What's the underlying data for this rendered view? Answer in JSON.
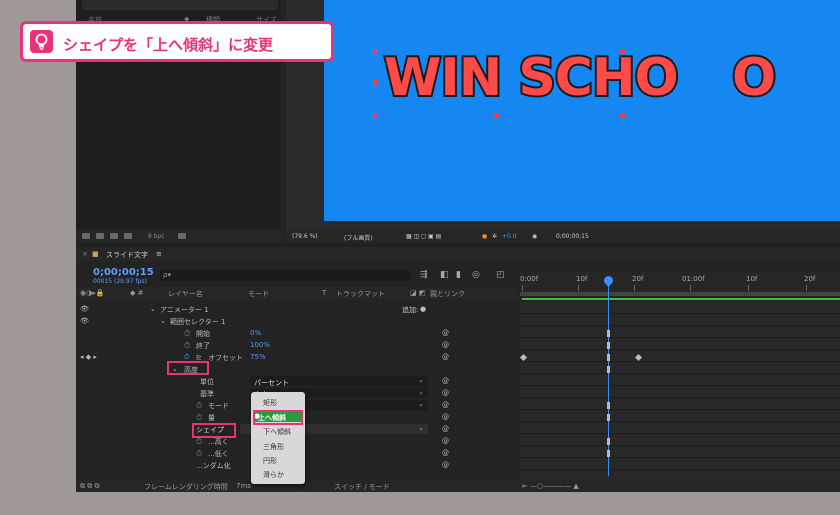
{
  "callout": {
    "text": "シェイプを「上へ傾斜」に変更",
    "icon": "lightbulb-icon",
    "color": "#e83279"
  },
  "project": {
    "col_name": "名前",
    "col_type": "種類",
    "col_size": "サイズ",
    "bpc": "8 bpc"
  },
  "viewer": {
    "text_left": "WIN SCHO",
    "text_right": "O",
    "zoom": "(79.6 %)",
    "quality": "(フル画質)",
    "exposure": "+0.0",
    "timecode": "0;00;00;15",
    "canvas_color": "#1687f0",
    "text_color": "#ff4a4a"
  },
  "timeline": {
    "comp_name": "スライド文字",
    "timecode": "0;00;00;15",
    "frame_info": "00015 (29.97 fps)",
    "search_placeholder": "ρ▾",
    "columns": {
      "layer_name": "レイヤー名",
      "mode": "モード",
      "t": "T",
      "track_matte": "トラックマット",
      "parent": "親とリンク"
    },
    "rows": {
      "animator": "アニメーター 1",
      "add": "追加:",
      "range_selector": "範囲セレクター 1",
      "start_label": "開始",
      "start_value": "0%",
      "end_label": "終了",
      "end_value": "100%",
      "offset_label": "オフセット",
      "offset_value": "75%",
      "advanced": "高度",
      "units_label": "単位",
      "units_value": "パーセント",
      "based_on": "基準",
      "based_value": "文字",
      "mode_label": "モード",
      "amount_label": "量",
      "shape_label": "シェイプ",
      "ease_high": "...高く",
      "ease_low": "...低く",
      "randomize": "...ンダム化"
    },
    "shape_menu": [
      "矩形",
      "上へ傾斜",
      "下へ傾斜",
      "三角形",
      "円形",
      "滑らか"
    ],
    "shape_selected": "上へ傾斜",
    "ruler_labels": [
      "0:00f",
      "10f",
      "20f",
      "01:00f",
      "10f",
      "20f"
    ],
    "footer_render": "フレームレンダリング時間",
    "footer_render_value": "7ms",
    "footer_switch": "スイッチ / モード"
  }
}
